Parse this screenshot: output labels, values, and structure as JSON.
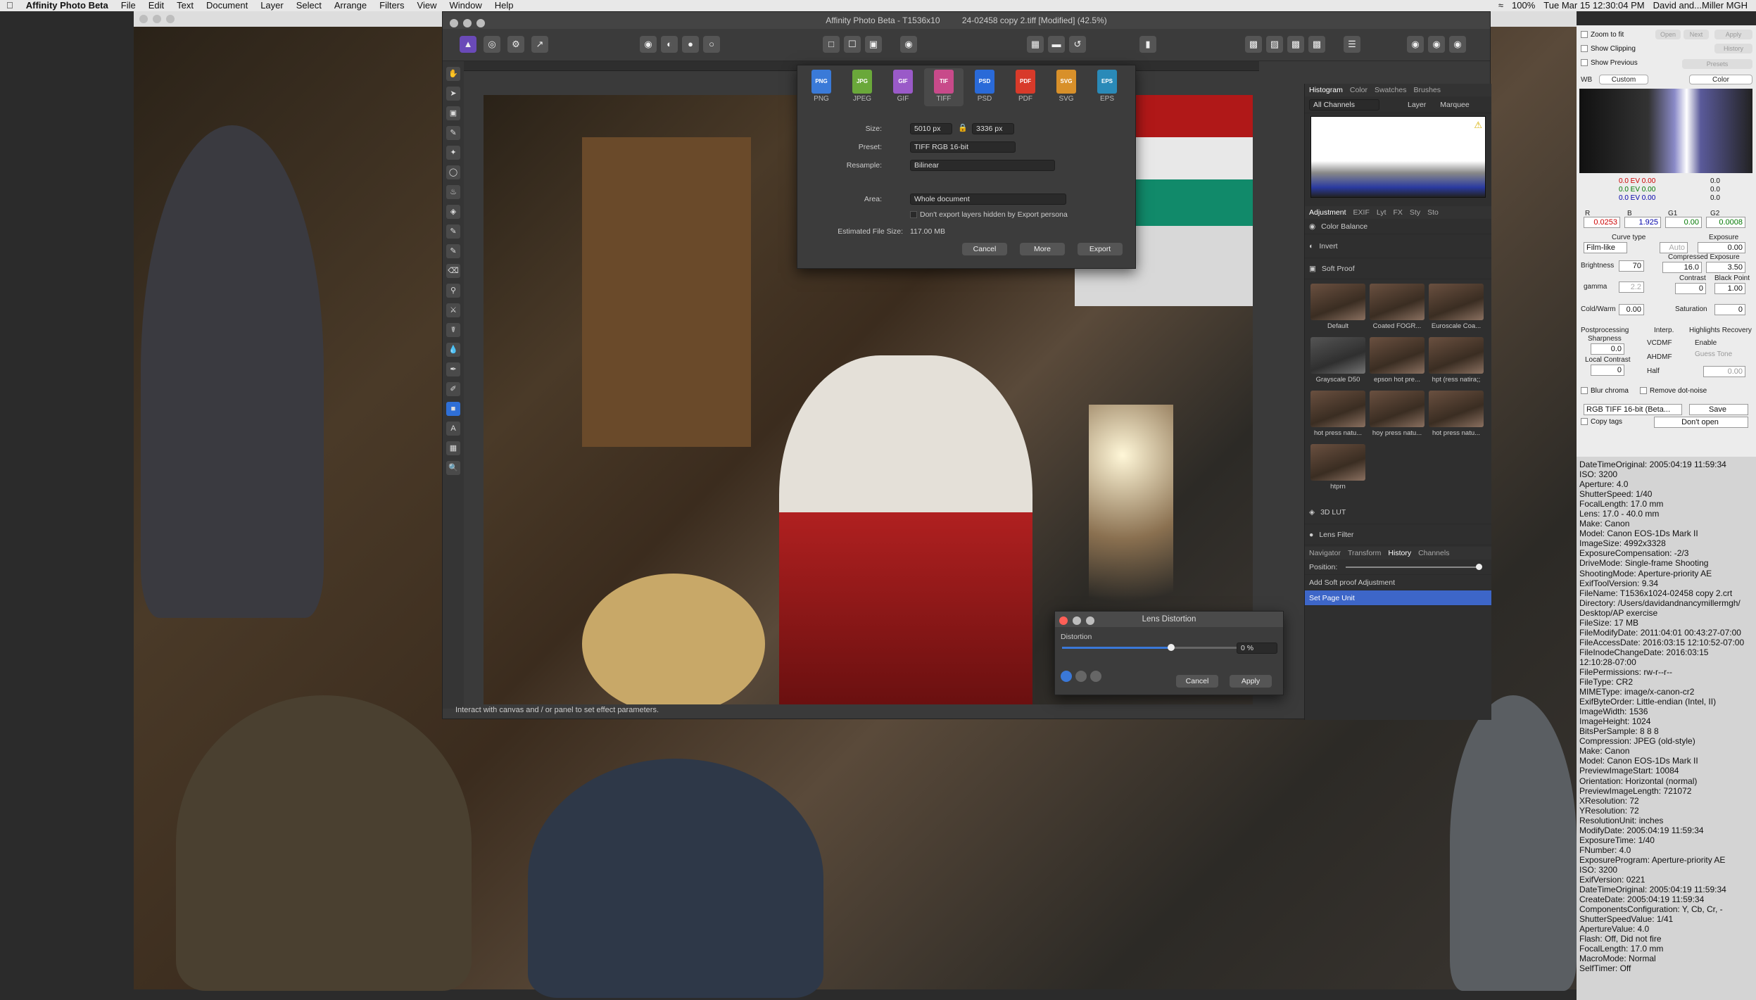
{
  "menubar": {
    "app": "Affinity Photo Beta",
    "items": [
      "File",
      "Edit",
      "Text",
      "Document",
      "Layer",
      "Select",
      "Arrange",
      "Filters",
      "View",
      "Window",
      "Help"
    ],
    "status": {
      "battery": "100%",
      "datetime": "Tue Mar 15  12:30:04 PM",
      "user": "David and...Miller MGH"
    }
  },
  "window": {
    "title": "Affinity Photo Beta - T1536x10",
    "doc_title": "24-02458 copy 2.tiff [Modified] (42.5%)",
    "status_hint": "Interact with canvas and / or panel to set effect parameters."
  },
  "export": {
    "formats": [
      "PNG",
      "JPEG",
      "GIF",
      "TIFF",
      "PSD",
      "PDF",
      "SVG",
      "EPS"
    ],
    "selected": "TIFF",
    "size_label": "Size:",
    "width": "5010 px",
    "height": "3336 px",
    "preset_label": "Preset:",
    "preset": "TIFF RGB 16-bit",
    "resample_label": "Resample:",
    "resample": "Bilinear",
    "area_label": "Area:",
    "area": "Whole document",
    "hidden_label": "Don't export layers hidden by Export persona",
    "filesize_label": "Estimated File Size:",
    "filesize": "117.00 MB",
    "cancel": "Cancel",
    "more": "More",
    "export": "Export"
  },
  "lens": {
    "title": "Lens Distortion",
    "label": "Distortion",
    "value": "0 %",
    "level": 0.62,
    "cancel": "Cancel",
    "apply": "Apply"
  },
  "panel": {
    "tabs": [
      "Histogram",
      "Color",
      "Swatches",
      "Brushes"
    ],
    "channels": "All Channels",
    "layer": "Layer",
    "marquee": "Marquee",
    "adj_tabs": [
      "Adjustment",
      "EXIF",
      "Lyt",
      "FX",
      "Sty",
      "Sto"
    ],
    "adjustments": [
      "Color Balance",
      "Invert",
      "Soft Proof"
    ],
    "presets": [
      "Default",
      "Coated FOGR...",
      "Euroscale Coa...",
      "Grayscale D50",
      "epson hot pre...",
      "hpt (ress natira;;",
      "hot press natu...",
      "hoy press natu...",
      "hot press natu...",
      "htprn"
    ],
    "more_adj": [
      "3D LUT",
      "Lens Filter"
    ],
    "hist_tabs": [
      "Navigator",
      "Transform",
      "History",
      "Channels"
    ],
    "position": "Position:",
    "history": [
      "Add Soft proof Adjustment",
      "Set Page Unit"
    ]
  },
  "rawpanel": {
    "zoom": "Zoom to fit",
    "clipping": "Show Clipping",
    "previous": "Show Previous",
    "open": "Open",
    "next": "Next",
    "apply": "Apply",
    "history": "History",
    "presets": "Presets",
    "wb": "WB",
    "wb_val": "Custom",
    "color": "Color",
    "readout": {
      "r": "0.0 EV 0.00",
      "g": "0.0 EV 0.00",
      "b": "0.0 EV 0.00",
      "l": "0.0",
      "a": "0.0",
      "bb": "0.0"
    },
    "R": "R",
    "B": "B",
    "G1": "G1",
    "G2": "G2",
    "rv": "0.0253",
    "bv": "1.925",
    "g1v": "0.00",
    "g2v": "0.0008",
    "curve_type": "Curve type",
    "curve": "Film-like",
    "exposure": "Exposure",
    "exposure_v": "0.00",
    "auto": "Auto",
    "brightness": "Brightness",
    "brightness_v": "70",
    "comp": "Compressed Exposure",
    "comp_v1": "16.0",
    "comp_v2": "3.50",
    "gamma": "gamma",
    "gamma_v": "2.2",
    "contrast": "Contrast",
    "contrast_v": "0",
    "blackpoint": "Black Point",
    "bp_v": "1.00",
    "coldwarm": "Cold/Warm",
    "cw_v": "0.00",
    "saturation": "Saturation",
    "sat_v": "0",
    "post": "Postprocessing",
    "sharp": "Sharpness",
    "sharp_v": "0.0",
    "local": "Local Contrast",
    "local_v": "0",
    "interp": "Interp.",
    "vcd": "VCDMF",
    "ahd": "AHDMF",
    "half": "Half",
    "hl": "Highlights Recovery",
    "enable": "Enable",
    "guess": "Guess Tone",
    "hl_v": "0.00",
    "blur": "Blur chroma",
    "dots": "Remove dot-noise",
    "format": "RGB TIFF 16-bit (Beta...",
    "save": "Save",
    "copytags": "Copy tags",
    "dontopen": "Don't open"
  },
  "exif": [
    "DateTimeOriginal: 2005:04:19 11:59:34",
    "ISO: 3200",
    "Aperture: 4.0",
    "ShutterSpeed: 1/40",
    "FocalLength: 17.0 mm",
    "Lens: 17.0 - 40.0 mm",
    "Make: Canon",
    "Model: Canon EOS-1Ds Mark II",
    "ImageSize: 4992x3328",
    "ExposureCompensation: -2/3",
    "DriveMode: Single-frame Shooting",
    "ShootingMode: Aperture-priority AE",
    "ExifToolVersion: 9.34",
    "FileName: T1536x1024-02458 copy 2.crt",
    "Directory: /Users/davidandnancymillermgh/",
    "Desktop/AP exercise",
    "FileSize: 17 MB",
    "FileModifyDate: 2011:04:01 00:43:27-07:00",
    "FileAccessDate: 2016:03:15 12:10:52-07:00",
    "FileInodeChangeDate: 2016:03:15",
    "12:10:28-07:00",
    "FilePermissions: rw-r--r--",
    "FileType: CR2",
    "MIMEType: image/x-canon-cr2",
    "ExifByteOrder: Little-endian (Intel, II)",
    "ImageWidth: 1536",
    "ImageHeight: 1024",
    "BitsPerSample: 8 8 8",
    "Compression: JPEG (old-style)",
    "Make: Canon",
    "Model: Canon EOS-1Ds Mark II",
    "PreviewImageStart: 10084",
    "Orientation: Horizontal (normal)",
    "PreviewImageLength: 721072",
    "XResolution: 72",
    "YResolution: 72",
    "ResolutionUnit: inches",
    "ModifyDate: 2005:04:19 11:59:34",
    "ExposureTime: 1/40",
    "FNumber: 4.0",
    "ExposureProgram: Aperture-priority AE",
    "ISO: 3200",
    "ExifVersion: 0221",
    "DateTimeOriginal: 2005:04:19 11:59:34",
    "CreateDate: 2005:04:19 11:59:34",
    "ComponentsConfiguration: Y, Cb, Cr, -",
    "ShutterSpeedValue: 1/41",
    "ApertureValue: 4.0",
    "Flash: Off, Did not fire",
    "FocalLength: 17.0 mm",
    "MacroMode: Normal",
    "SelfTimer: Off"
  ]
}
